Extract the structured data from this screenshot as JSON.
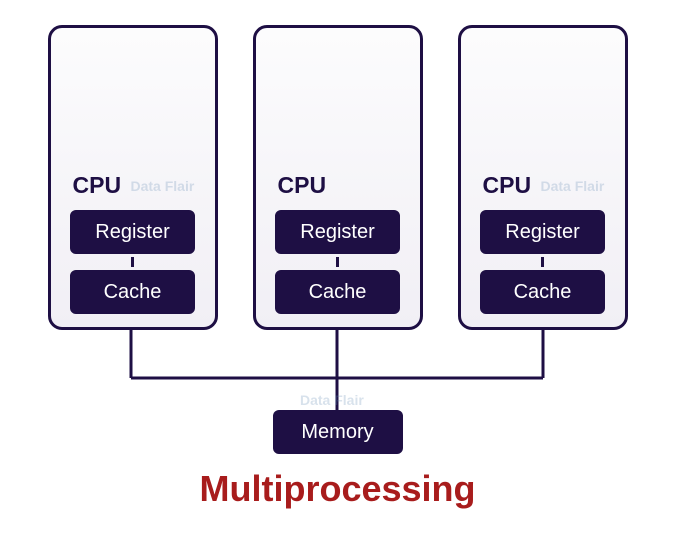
{
  "title": "Multiprocessing",
  "cpus": [
    {
      "label": "CPU",
      "register": "Register",
      "cache": "Cache"
    },
    {
      "label": "CPU",
      "register": "Register",
      "cache": "Cache"
    },
    {
      "label": "CPU",
      "register": "Register",
      "cache": "Cache"
    }
  ],
  "memory": {
    "label": "Memory"
  },
  "watermark": "Data Flair",
  "colors": {
    "box_dark": "#1e0f44",
    "title": "#a81c1c",
    "box_fill_top": "#fcfcfd",
    "box_fill_bottom": "#f1eff5"
  }
}
